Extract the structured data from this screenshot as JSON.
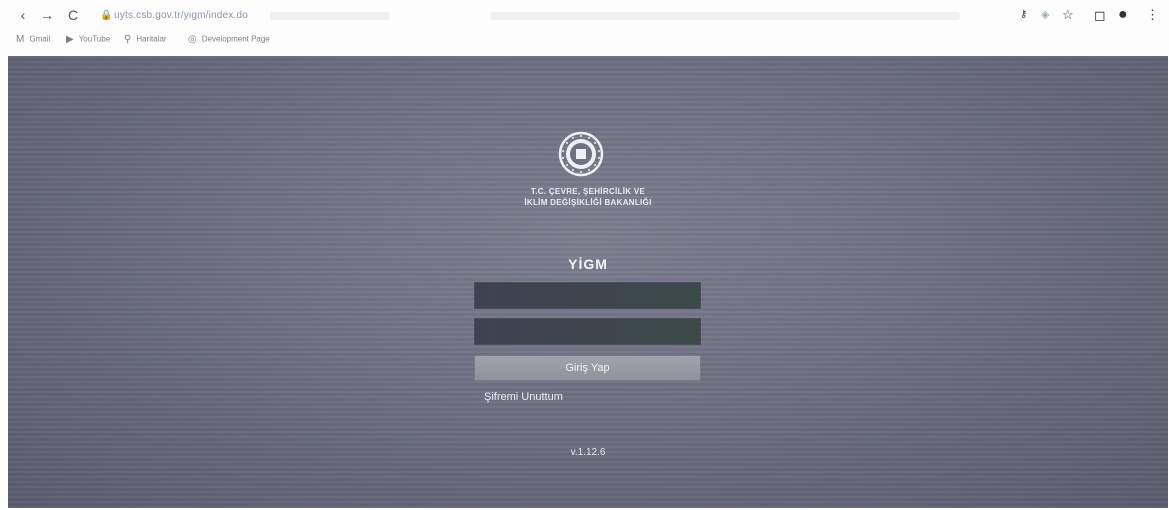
{
  "browser": {
    "url": "uyts.csb.gov.tr/yigm/index.do",
    "bookmarks": [
      {
        "icon": "gmail-icon",
        "label": "Gmail"
      },
      {
        "icon": "youtube-icon",
        "label": "YouTube"
      },
      {
        "icon": "maps-icon",
        "label": "Haritalar"
      },
      {
        "icon": "chrome-icon",
        "label": "Development Page"
      }
    ]
  },
  "login": {
    "ministry_line1": "T.C. ÇEVRE, ŞEHİRCİLİK VE",
    "ministry_line2": "İKLİM DEĞİŞİKLİĞİ BAKANLIĞI",
    "app_title": "YİGM",
    "username_value": "",
    "password_value": "",
    "login_button": "Giriş Yap",
    "forgot_password": "Şifremi Unuttum",
    "version": "v.1.12.6"
  },
  "colors": {
    "background": "#6e7083",
    "field_bg": "#3f4150",
    "button_bg": "#9a9ca6"
  }
}
